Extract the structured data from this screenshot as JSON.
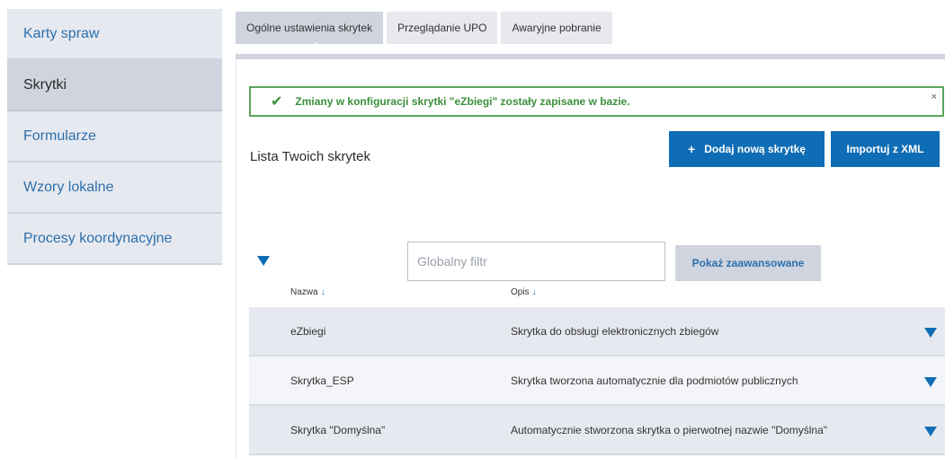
{
  "sidebar": {
    "items": [
      {
        "label": "Karty spraw"
      },
      {
        "label": "Skrytki"
      },
      {
        "label": "Formularze"
      },
      {
        "label": "Wzory lokalne"
      },
      {
        "label": "Procesy koordynacyjne"
      }
    ]
  },
  "tabs": [
    {
      "label": "Ogólne ustawienia skrytek"
    },
    {
      "label": "Przeglądanie UPO"
    },
    {
      "label": "Awaryjne pobranie"
    }
  ],
  "alert": {
    "message": "Zmiany w konfiguracji skrytki \"eZbiegi\" zostały zapisane w bazie.",
    "close": "×"
  },
  "list": {
    "title": "Lista Twoich skrytek",
    "add_button": "Dodaj nową skrytkę",
    "add_icon": "+",
    "import_button": "Importuj z XML"
  },
  "filter": {
    "placeholder": "Globalny filtr",
    "advanced_button": "Pokaż zaawansowane"
  },
  "table": {
    "columns": [
      {
        "label": "Nazwa",
        "sort": "↓"
      },
      {
        "label": "Opis",
        "sort": "↓"
      }
    ],
    "rows": [
      {
        "name": "eZbiegi",
        "desc": "Skrytka do obsługi elektronicznych zbiegów"
      },
      {
        "name": "Skrytka_ESP",
        "desc": "Skrytka tworzona automatycznie dla podmiotów publicznych"
      },
      {
        "name": "Skrytka \"Domyślna\"",
        "desc": "Automatycznie stworzona skrytka o pierwotnej nazwie \"Domyślna\""
      }
    ]
  },
  "colors": {
    "accent": "#0f6db5",
    "success": "#3b8f3b",
    "sidebar_bg": "#e6e9f0",
    "sidebar_active_bg": "#cfd4de"
  }
}
